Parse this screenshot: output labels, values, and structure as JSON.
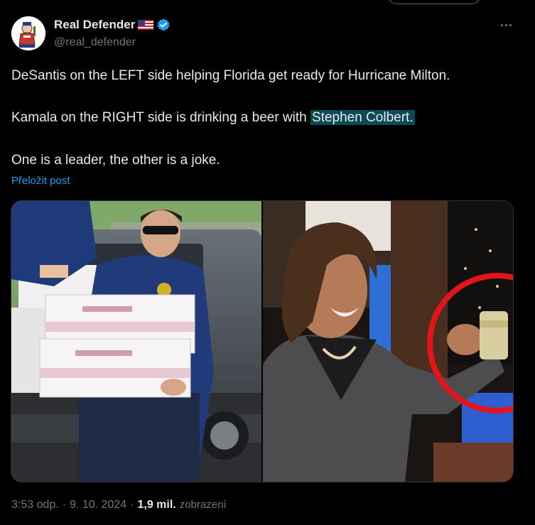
{
  "author": {
    "display_name": "Real Defender",
    "handle": "@real_defender",
    "flag_icon": "us-flag-icon",
    "verified_icon": "verified-badge-icon"
  },
  "tweet": {
    "line1": "DeSantis on the LEFT side helping Florida get ready for Hurricane Milton.",
    "line2_prefix": "Kamala on the RIGHT side is drinking a beer with ",
    "line2_mention": "Stephen Colbert.",
    "line3": "One is a leader, the other is a joke.",
    "translate_label": "Přeložit post"
  },
  "meta": {
    "time": "3:53 odp.",
    "separator": "·",
    "date": "9. 10. 2024",
    "views_count": "1,9 mil.",
    "views_label": "zobrazení"
  },
  "colors": {
    "background": "#000000",
    "text": "#e7e9ea",
    "secondary": "#71767b",
    "link": "#1d9bf0",
    "verified": "#1d9bf0",
    "mention_highlight": "#0c4a55",
    "circle_annotation": "#e3151b"
  }
}
